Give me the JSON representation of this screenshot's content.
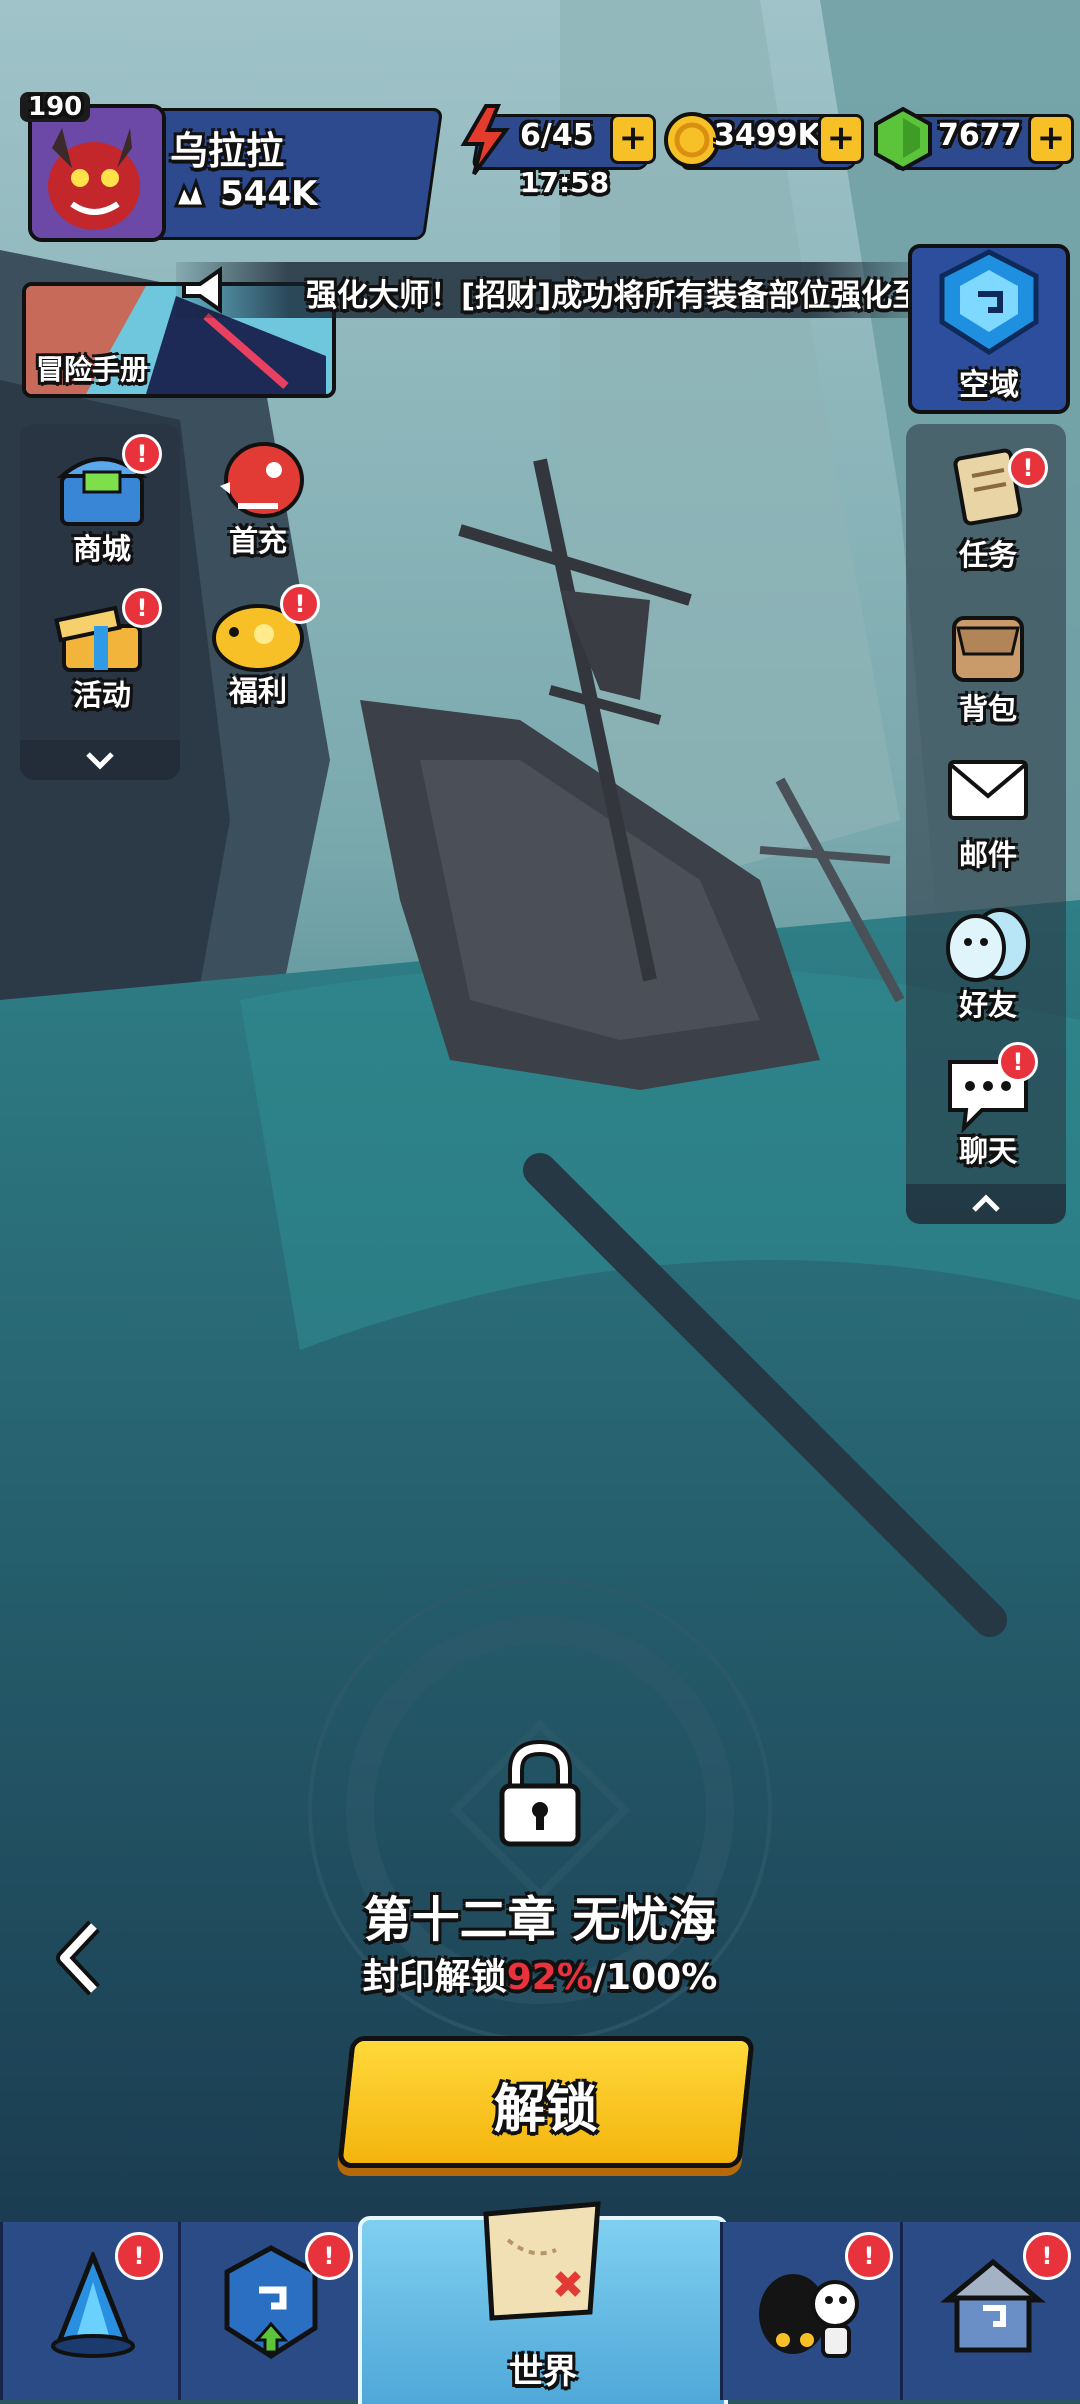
{
  "player": {
    "level": "190",
    "name": "乌拉拉",
    "power": "544K"
  },
  "resources": {
    "energy": "6/45",
    "energy_timer": "17:58",
    "gold": "3499K",
    "gems": "7677"
  },
  "banner": {
    "label": "冒险手册",
    "announcement": "强化大师！[招财]成功将所有装备部位强化至"
  },
  "airspace": {
    "label": "空域"
  },
  "left_menu": {
    "shop": "商城",
    "first_recharge": "首充",
    "events": "活动",
    "welfare": "福利"
  },
  "right_menu": {
    "tasks": "任务",
    "bag": "背包",
    "mail": "邮件",
    "friends": "好友",
    "chat": "聊天"
  },
  "chapter": {
    "title": "第十二章 无忧海",
    "progress_prefix": "封印解锁",
    "progress_value": "92%",
    "progress_suffix": "/100%",
    "unlock_button": "解锁"
  },
  "bottom_nav": {
    "world": "世界"
  },
  "badge_mark": "!",
  "colors": {
    "accent_yellow": "#f6c026",
    "badge_red": "#e8323c",
    "progress_red": "#e8323c",
    "nav_blue": "#2b4b86"
  }
}
